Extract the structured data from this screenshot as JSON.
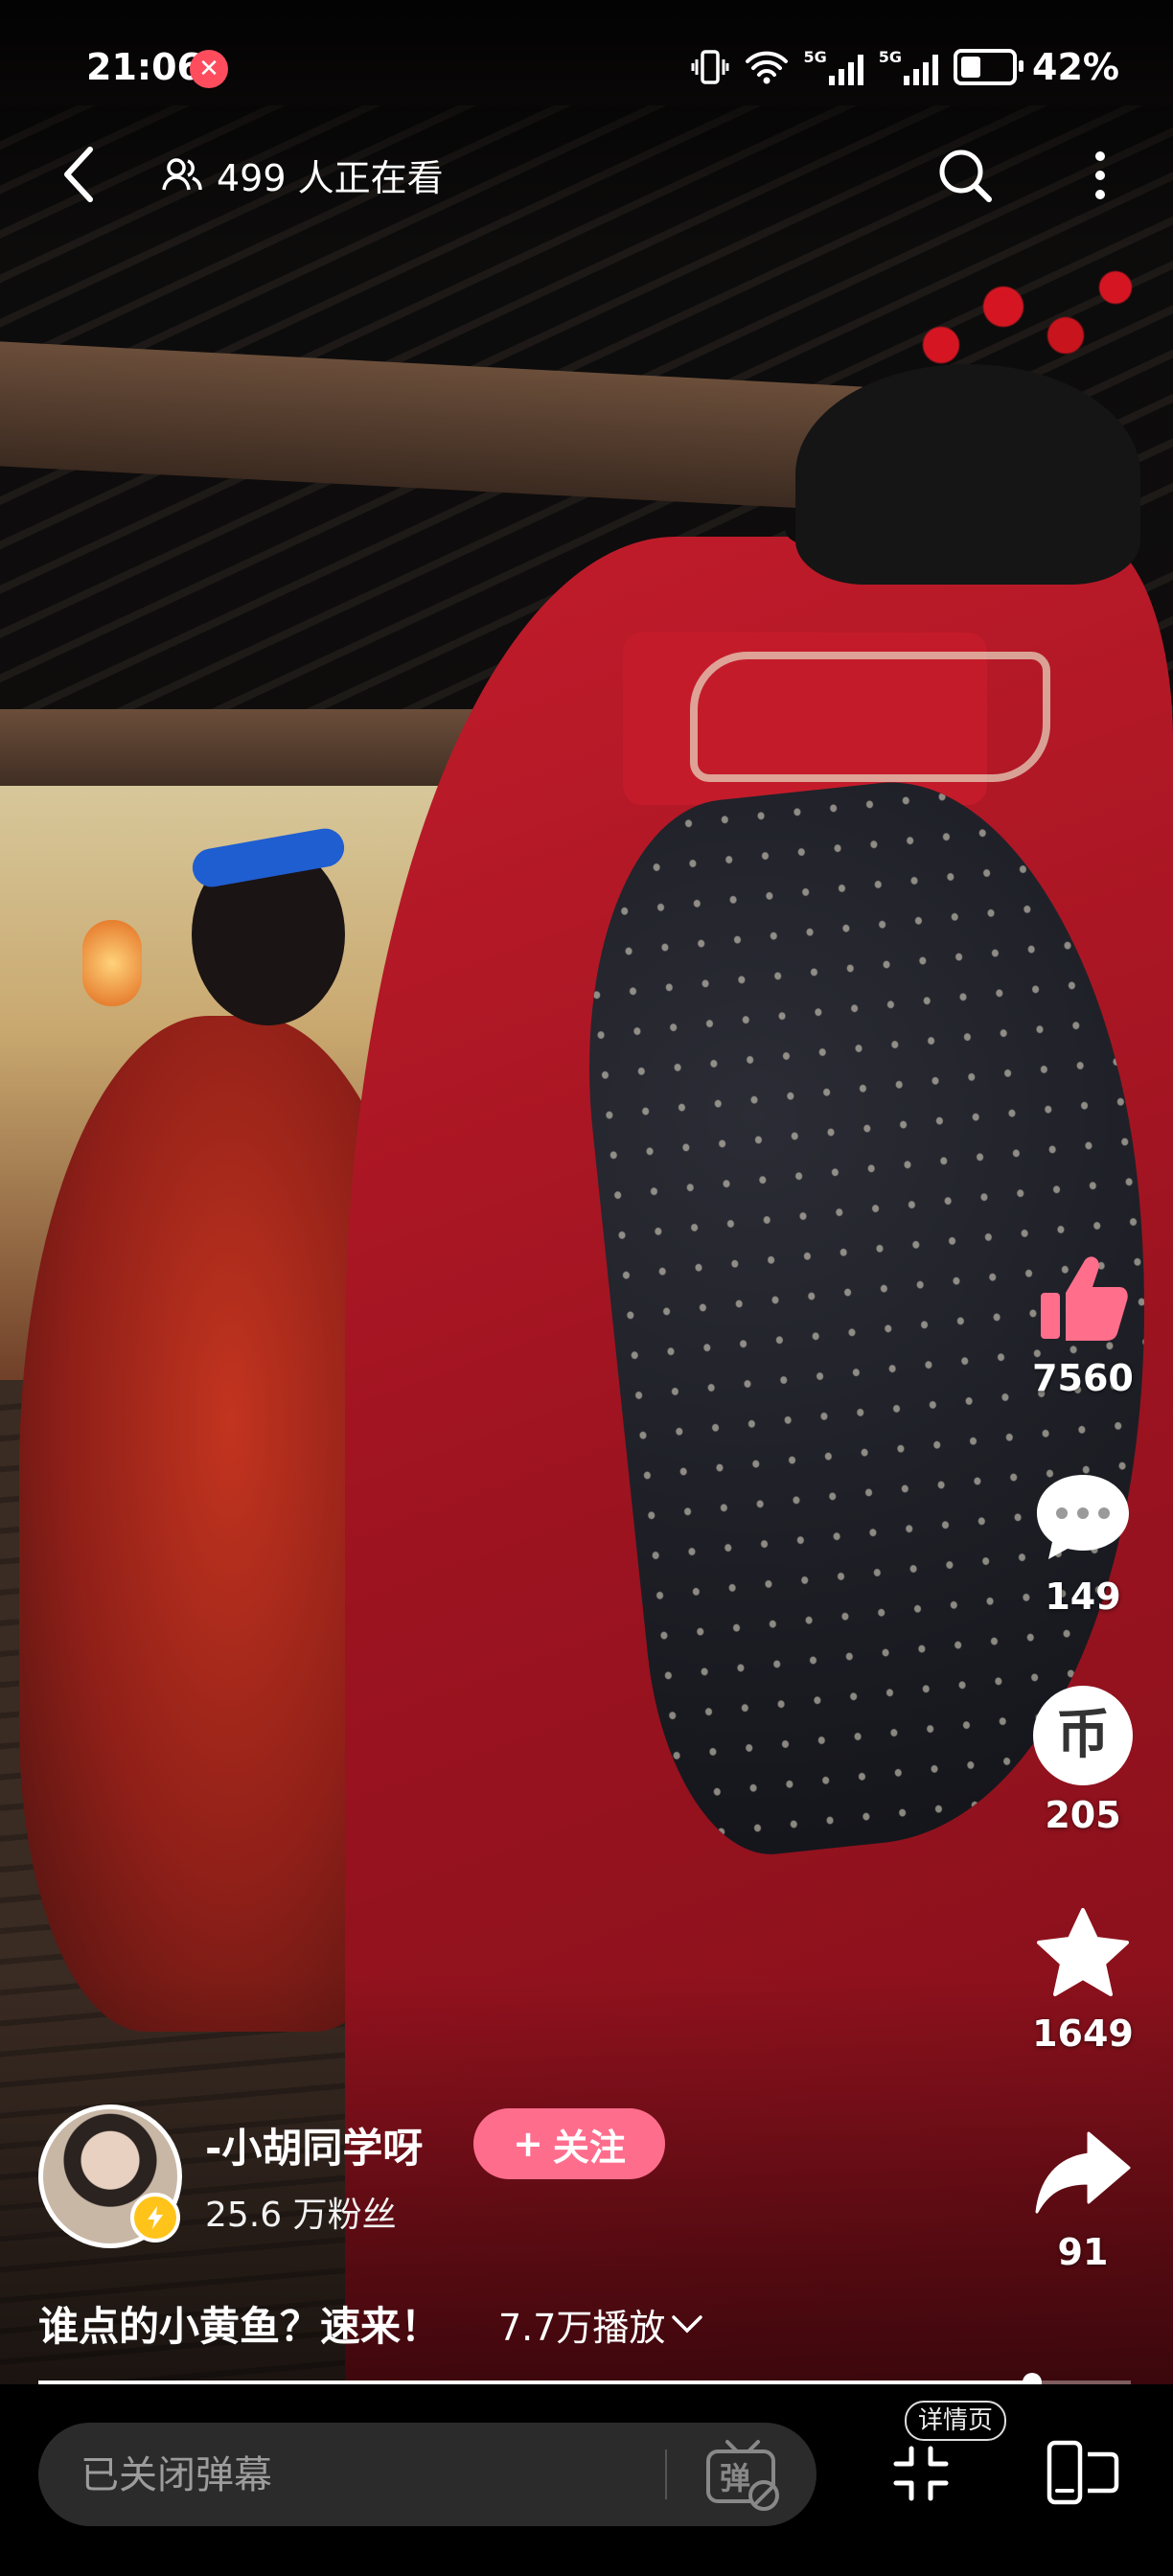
{
  "status_bar": {
    "time": "21:06",
    "record_icon": "x-badge-icon",
    "network": [
      "5G",
      "5G"
    ],
    "battery": "42%"
  },
  "top_bar": {
    "viewers_text": "499 人正在看"
  },
  "actions": {
    "like_count": "7560",
    "comment_count": "149",
    "coin_glyph": "币",
    "coin_count": "205",
    "favorite_count": "1649",
    "share_count": "91"
  },
  "author": {
    "name": "-小胡同学呀",
    "followers": "25.6 万粉丝",
    "follow_label": "关注",
    "follow_prefix": "+"
  },
  "caption": {
    "title": "谁点的小黄鱼？速来！",
    "plays": "7.7万播放"
  },
  "progress": {
    "fraction": 0.91
  },
  "bottom_bar": {
    "danmu_placeholder": "已关闭弹幕",
    "danmu_toggle_glyph": "弹",
    "detail_label": "详情页"
  },
  "colors": {
    "accent_pink": "#ff6d8d",
    "like_pink": "#ff6f8c",
    "verified_yellow": "#ffc31a"
  }
}
